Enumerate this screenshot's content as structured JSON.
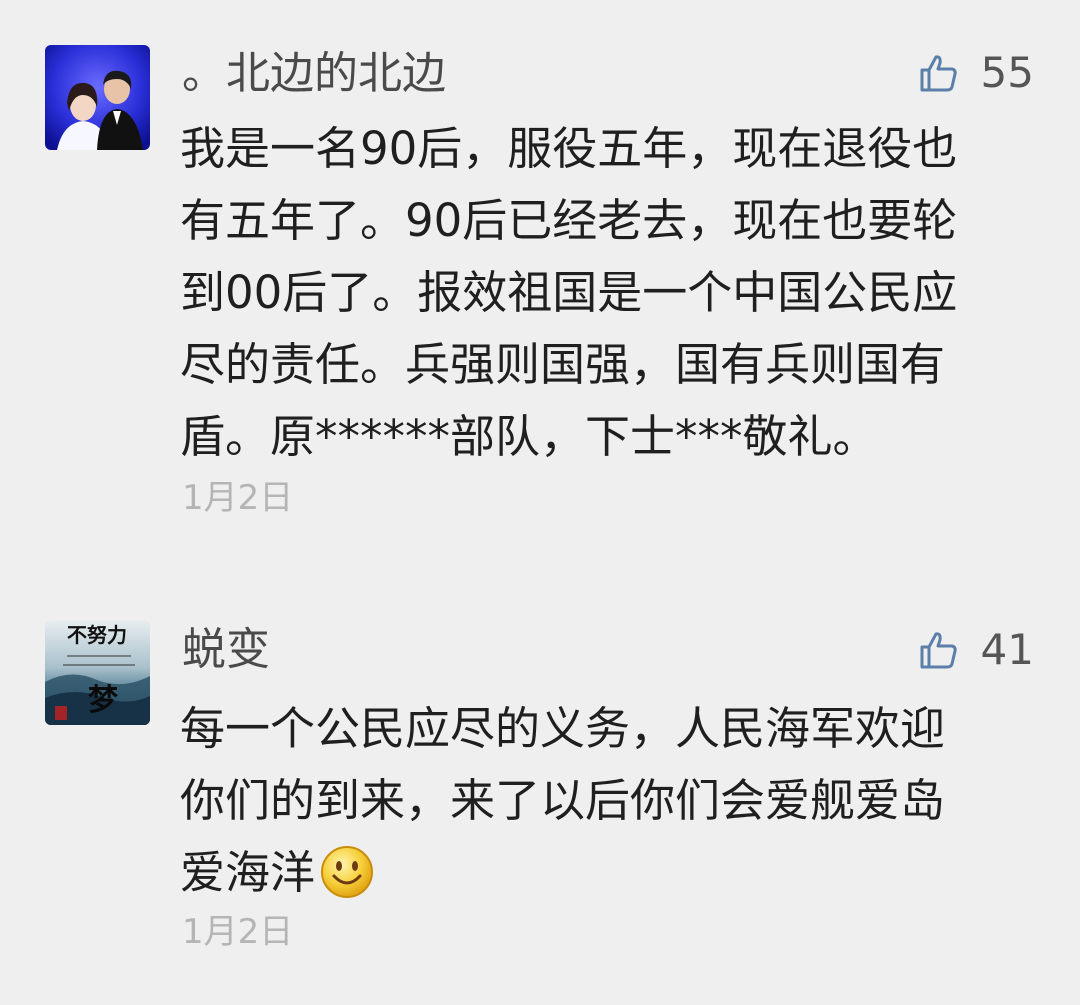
{
  "comments": [
    {
      "username": "。北边的北边",
      "likes": "55",
      "lines": [
        "我是一名90后，服役五年，现在退役也",
        "有五年了。90后已经老去，现在也要轮",
        "到00后了。报效祖国是一个中国公民应",
        "尽的责任。兵强则国强，国有兵则国有",
        "盾。原******部队，下士***敬礼。"
      ],
      "time": "1月2日",
      "avatar_icon": "couple-photo-avatar"
    },
    {
      "username": "蜕变",
      "likes": "41",
      "lines": [
        "每一个公民应尽的义务，人民海军欢迎",
        "你们的到来，来了以后你们会爱舰爱岛",
        "爱海洋"
      ],
      "emoji": "smiley-emoji",
      "time": "1月2日",
      "avatar_icon": "calligraphy-avatar",
      "avatar_text": {
        "top": "不努力",
        "bottom": "梦"
      }
    }
  ],
  "colors": {
    "background": "#efefef",
    "like_icon": "#5b7fa8",
    "text": "#1f1f1f",
    "username": "#4a4a4a",
    "time": "#b5b5b5"
  }
}
